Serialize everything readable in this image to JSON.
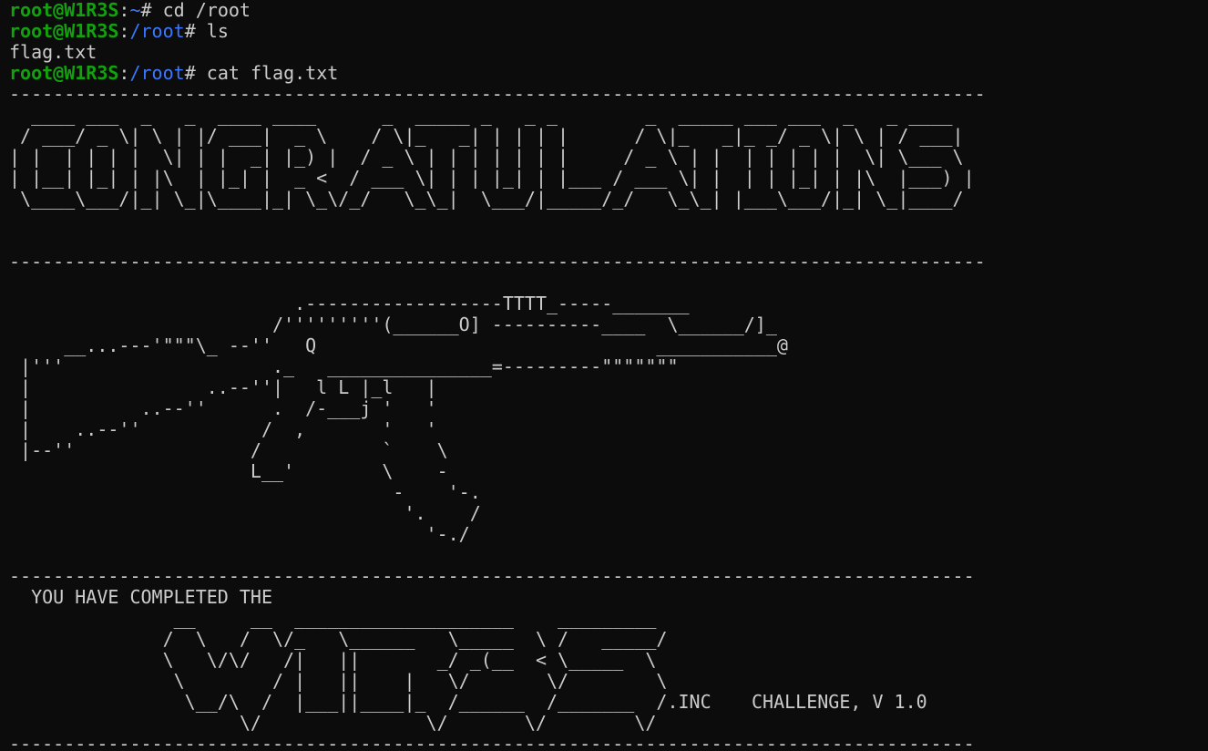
{
  "prompt": {
    "user_host": "root@W1R3S",
    "colon": ":",
    "suffix": "# "
  },
  "commands": [
    {
      "path": "~",
      "command": "cd /root"
    },
    {
      "path": "/root",
      "command": "ls"
    },
    {
      "output": "flag.txt"
    },
    {
      "path": "/root",
      "command": "cat flag.txt"
    }
  ],
  "separator_long": "-----------------------------------------------------------------------------------------",
  "separator_short": "----------------------------------------------------------------------------------------",
  "congratulations_art": "  ____ ___  _   _  ____ ____      _  _____ _   _ _        _  _____ ___ ___  _   _ ____  \n / ___/ _ \\| \\ | |/ ___|  _ \\    / \\|_   _| | | | |      / \\|_   _|_ _/ _ \\| \\ | / ___| \n| |  | | | |  \\| | |  _| |_) |  / _ \\ | | | | | | |     / _ \\ | |  | | | | |  \\| \\___ \\ \n| |__| |_| | |\\  | |_| |  _ <  / ___ \\| | | |_| | |___ / ___ \\| |  | | |_| | |\\  |___) |\n \\____\\___/|_| \\_|\\____|_| \\_\\/_/   \\_\\_|  \\___/|_____/_/   \\_\\_| |___\\___/|_| \\_|____/ ",
  "rifle_art": "                          .------------------TTTT_-----_______\n                        /'''''''''(______O] ----------____  \\______/]_\n     __...---'\"\"\"\\_ --''   Q                               ___________@\n |'''                   ._   _______________=---------\"\"\"\"\"\"\"\n |                ..--''|   l L |_l   |\n |          ..--''      .  /-___j '   '\n |    ..--''           /  ,       '   '\n |--''                /           `    \\\n                      L__'        \\    -\n                                   -    '-.\n                                    '.    /\n                                      '-./",
  "completed_text": "  YOU HAVE COMPLETED THE",
  "wires_art": "               __     __  ____________________    _________\n              /  \\   /  \\/_   \\______   \\_____  \\ /   _____/\n              \\   \\/\\/   /|   ||       _/ _(__  < \\_____  \\\n               \\        / |   ||    |   \\/       \\/        \\\n                \\__/\\  /  |___||____|_  /______  /_______  /.INC\n                     \\/               \\/       \\/        \\/",
  "challenge_text": "CHALLENGE, V 1.0",
  "colors": {
    "background": "#0c0c0c",
    "text": "#cccccc",
    "user": "#13a10e",
    "path": "#3b78ff"
  }
}
